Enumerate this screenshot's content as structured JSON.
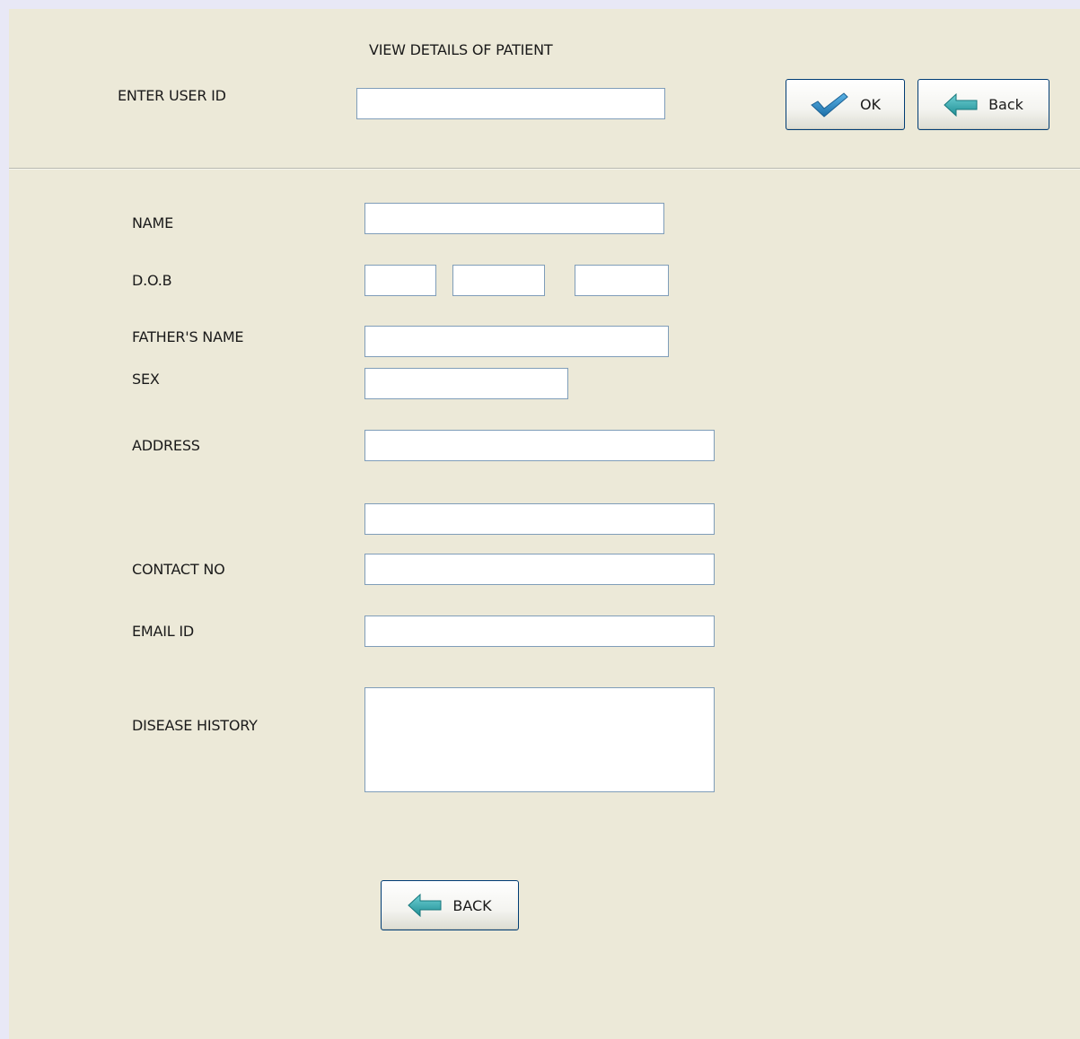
{
  "header": {
    "title": "VIEW DETAILS OF PATIENT",
    "user_id_label": "ENTER  USER ID",
    "user_id_value": "",
    "ok_label": "OK",
    "back_label": "Back"
  },
  "form": {
    "name_label": "NAME",
    "name_value": "",
    "dob_label": "D.O.B",
    "dob_day": "",
    "dob_month": "",
    "dob_year": "",
    "father_label": "FATHER'S NAME",
    "father_value": "",
    "sex_label": "SEX",
    "sex_value": "",
    "address_label": "ADDRESS",
    "address_line1": "",
    "address_line2": "",
    "contact_label": "CONTACT NO",
    "contact_value": "",
    "email_label": "EMAIL ID",
    "email_value": "",
    "disease_label": "DISEASE HISTORY",
    "disease_value": ""
  },
  "footer": {
    "back_label": "BACK"
  },
  "icons": {
    "ok": "checkmark-icon",
    "back": "arrow-left-icon"
  },
  "colors": {
    "background": "#ece9d8",
    "field_border": "#7f9db9",
    "button_border": "#003c74",
    "check_icon": "#2a86c4",
    "arrow_icon": "#2aa3a8"
  }
}
